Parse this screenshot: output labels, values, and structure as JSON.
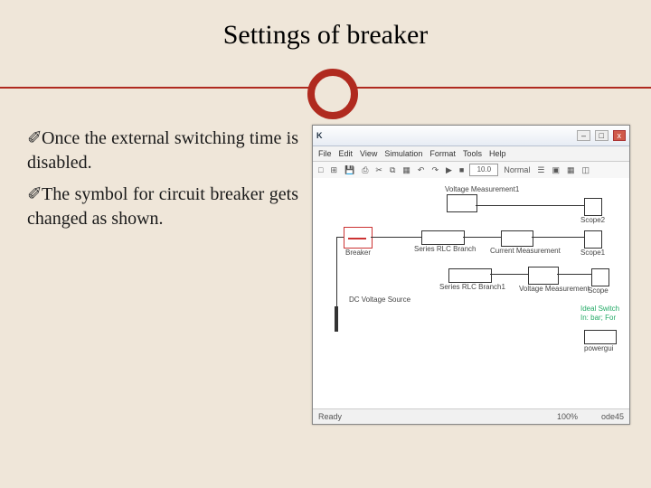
{
  "title": "Settings of breaker",
  "bullets": [
    "Once the external switching time is disabled.",
    "The symbol for circuit breaker gets changed as shown."
  ],
  "bullet_glyph": "✐",
  "sim": {
    "window_title": "K",
    "win_min": "–",
    "win_max": "□",
    "win_close": "x",
    "menu": [
      "File",
      "Edit",
      "View",
      "Simulation",
      "Format",
      "Tools",
      "Help"
    ],
    "toolbar": {
      "new": "□",
      "open": "⊞",
      "save": "💾",
      "print": "⎙",
      "cut": "✂",
      "copy": "⧉",
      "paste": "▦",
      "undo": "↶",
      "redo": "↷",
      "start": "▶",
      "stop": "■",
      "stop_time": "10.0",
      "mode": "Normal",
      "lib": "☰",
      "model": "▣",
      "scope": "▦",
      "build": "◫"
    },
    "labels": {
      "vm1": "Voltage Measurement1",
      "scope2": "Scope2",
      "breaker": "Breaker",
      "rlc": "Series RLC Branch",
      "cm": "Current Measurement",
      "scope1": "Scope1",
      "dc": "DC Voltage Source",
      "rlc1": "Series RLC Branch1",
      "vm": "Voltage Measurement",
      "scope": "Scope",
      "ideal": "Ideal Switch",
      "busbar": "In: bar; For",
      "powergui": "powergui"
    },
    "status": {
      "ready": "Ready",
      "zoom": "100%",
      "solver": "ode45"
    }
  }
}
